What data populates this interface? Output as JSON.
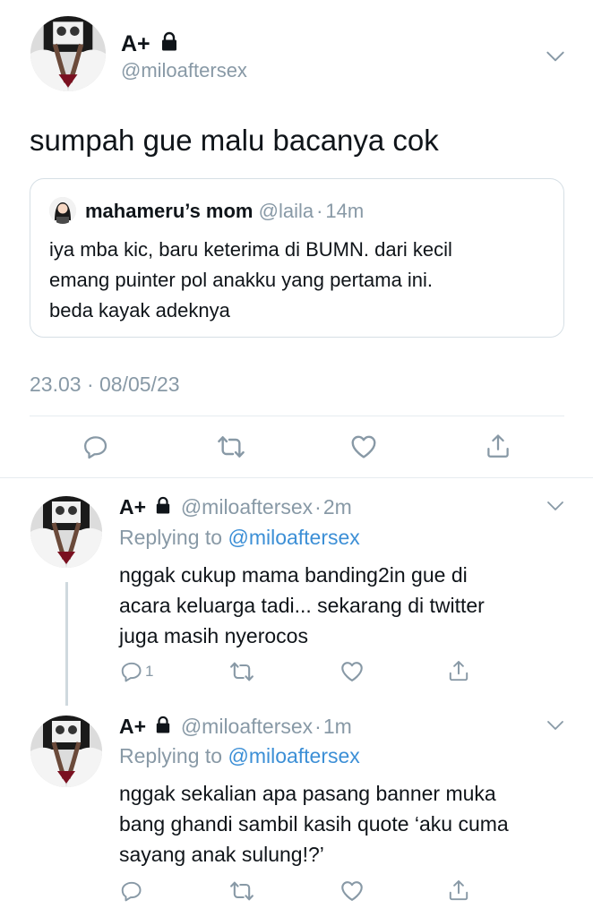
{
  "main_tweet": {
    "display_name": "A+",
    "handle": "@miloaftersex",
    "text": "sumpah gue malu bacanya cok",
    "timestamp": "23.03 · 08/05/23",
    "avatar_icon": "user-avatar-photo",
    "quoted": {
      "display_name": "mahameru’s mom",
      "handle": "@laila",
      "sep": "·",
      "time": "14m",
      "lines": [
        "iya mba kic, baru keterima di BUMN. dari kecil",
        "emang puinter pol anakku yang pertama ini.",
        "beda kayak adeknya"
      ]
    }
  },
  "replies": [
    {
      "display_name": "A+",
      "handle": "@miloaftersex",
      "sep": "·",
      "time": "2m",
      "replying_prefix": "Replying to",
      "replying_to": "@miloaftersex",
      "lines": [
        "nggak cukup mama banding2in gue di",
        "acara keluarga tadi... sekarang di twitter",
        "juga masih nyerocos"
      ],
      "reply_count": "1"
    },
    {
      "display_name": "A+",
      "handle": "@miloaftersex",
      "sep": "·",
      "time": "1m",
      "replying_prefix": "Replying to",
      "replying_to": "@miloaftersex",
      "lines": [
        "nggak sekalian apa pasang banner muka",
        "bang ghandi sambil kasih quote ‘aku cuma",
        "sayang anak sulung!?’"
      ],
      "reply_count": ""
    }
  ],
  "colors": {
    "text": "#0f1419",
    "secondary": "#8899a6",
    "link": "#3c8fd6",
    "divider": "#e6ecf0"
  },
  "icons": [
    "lock-icon",
    "chevron-down-icon",
    "reply-icon",
    "retweet-icon",
    "like-icon",
    "share-icon"
  ]
}
